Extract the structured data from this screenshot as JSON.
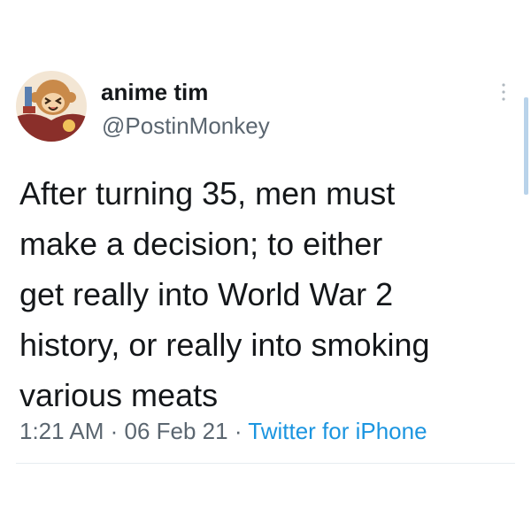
{
  "tweet": {
    "display_name": "anime tim",
    "handle": "@PostinMonkey",
    "text_lines": [
      "After turning 35, men must",
      "make a decision; to either",
      "get really into World War 2",
      "history, or really into smoking",
      "various meats"
    ],
    "time": "1:21 AM",
    "separator": " · ",
    "date": "06 Feb 21",
    "source": "Twitter for iPhone"
  },
  "icons": {
    "avatar": "avatar-icon",
    "more": "more-options-icon"
  },
  "colors": {
    "text": "#14171a",
    "secondary": "#5b6670",
    "link": "#1b95e0",
    "divider": "#e6ecf0"
  }
}
